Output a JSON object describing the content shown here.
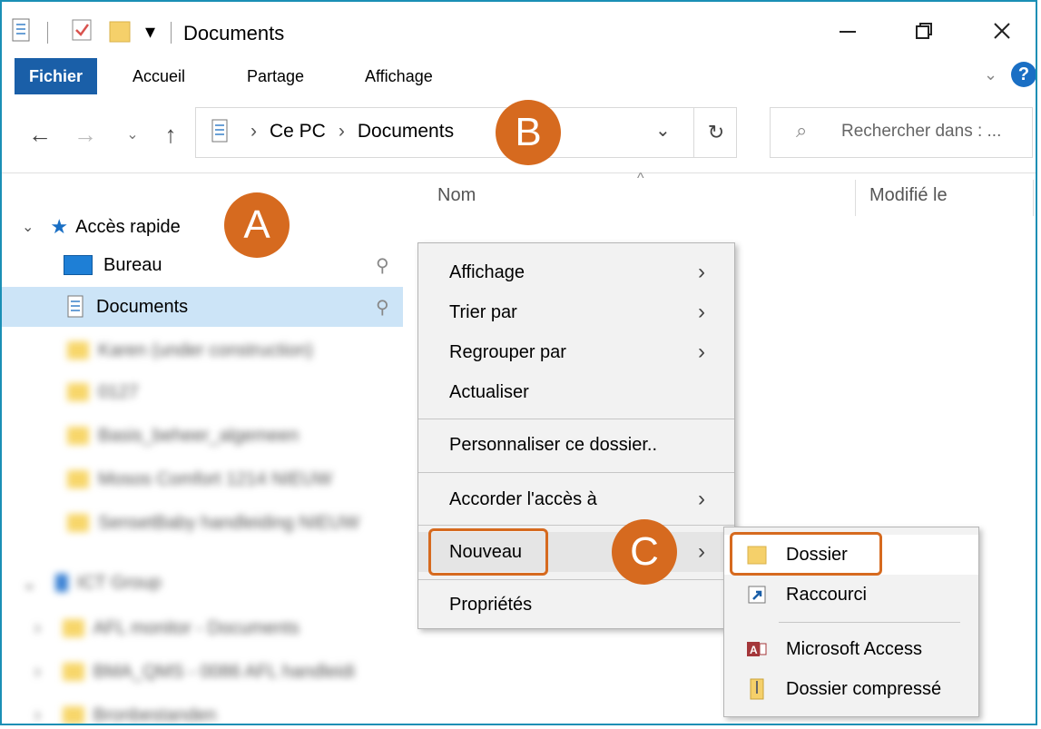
{
  "window": {
    "title": "Documents",
    "quick_access_dropdown": "▾"
  },
  "ribbon": {
    "tabs": [
      "Fichier",
      "Accueil",
      "Partage",
      "Affichage"
    ]
  },
  "address": {
    "crumbs": [
      "Ce PC",
      "Documents"
    ],
    "search_placeholder": "Rechercher dans : ..."
  },
  "nav": {
    "quick_access": "Accès rapide",
    "items": [
      {
        "label": "Bureau",
        "pinned": true,
        "icon": "desktop-icon"
      },
      {
        "label": "Documents",
        "pinned": true,
        "icon": "documents-icon",
        "selected": true
      },
      {
        "label": "Karen (under construction)",
        "blurred": true
      },
      {
        "label": "0127",
        "blurred": true
      },
      {
        "label": "Basis_beheer_algemeen",
        "blurred": true
      },
      {
        "label": "Mosos Comfort 1214 NIEUW",
        "blurred": true
      },
      {
        "label": "SensetBaby handleiding NIEUW",
        "blurred": true
      },
      {
        "label": "ICT Group",
        "blurred": true
      },
      {
        "label": "AFL monitor - Documents",
        "blurred": true
      },
      {
        "label": "BMA_QMS - 0086 AFL handleidi",
        "blurred": true
      },
      {
        "label": "Bronbestanden",
        "blurred": true
      }
    ]
  },
  "columns": {
    "name": "Nom",
    "modified": "Modifié le"
  },
  "context_menu": {
    "items": [
      {
        "label": "Affichage",
        "submenu": true
      },
      {
        "label": "Trier par",
        "submenu": true
      },
      {
        "label": "Regrouper par",
        "submenu": true
      },
      {
        "label": "Actualiser",
        "submenu": false
      },
      {
        "label": "Personnaliser ce dossier..",
        "submenu": false
      },
      {
        "label": "Accorder l'accès à",
        "submenu": true
      },
      {
        "label": "Nouveau",
        "submenu": true
      },
      {
        "label": "Propriétés",
        "submenu": false
      }
    ]
  },
  "new_submenu": {
    "items": [
      {
        "label": "Dossier",
        "icon": "folder-icon"
      },
      {
        "label": "Raccourci",
        "icon": "shortcut-icon"
      },
      {
        "label": "Microsoft Access",
        "icon": "access-icon"
      },
      {
        "label": "Dossier compressé",
        "icon": "zip-folder-icon"
      }
    ]
  },
  "annotations": [
    "A",
    "B",
    "C"
  ],
  "colors": {
    "accent_orange": "#d66a1f",
    "ribbon_active": "#1a5fa8",
    "selection": "#cce4f7"
  }
}
